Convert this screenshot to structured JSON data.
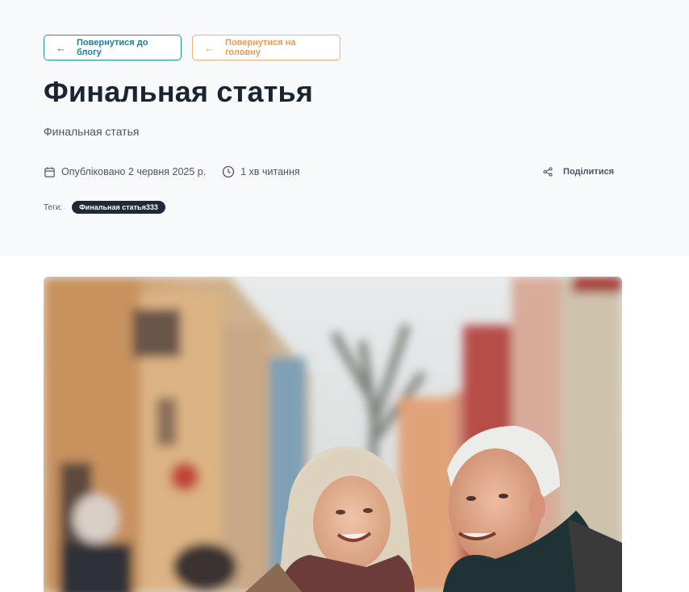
{
  "nav": {
    "back_to_blog": "Повернутися до блогу",
    "back_to_home": "Повернутися на головну"
  },
  "article": {
    "title": "Финальная статья",
    "subtitle": "Финальная статья",
    "published": "Опубліковано 2 червня 2025 р.",
    "read_time": "1 хв читання",
    "share_label": "Поділитися",
    "tags_label": "Теги:",
    "tags": [
      "Финальная статья333"
    ]
  },
  "colors": {
    "accent_blue": "#1a93b0",
    "accent_orange": "#f2b27a",
    "title": "#1a2433",
    "hero_bg": "#f7f9fb",
    "tag_bg": "#1f2937"
  },
  "icons": {
    "arrow": "arrow-left-icon",
    "calendar": "calendar-icon",
    "clock": "clock-icon",
    "share": "share-icon"
  }
}
